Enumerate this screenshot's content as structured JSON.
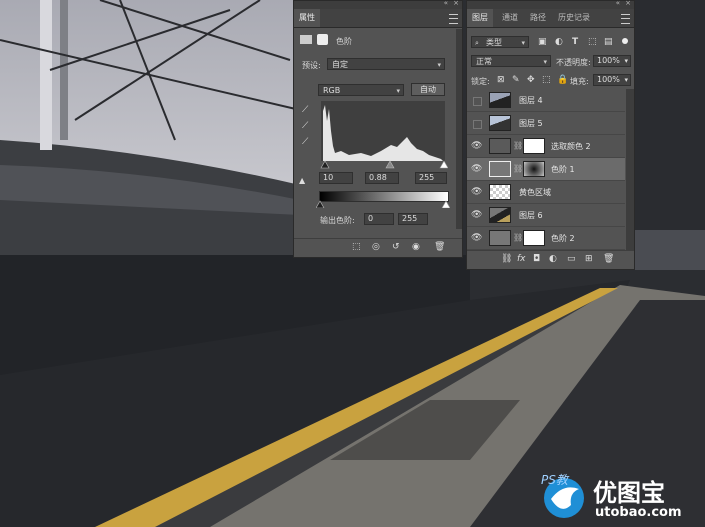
{
  "properties": {
    "tab_title": "属性",
    "adjustment_name": "色阶",
    "preset_label": "预设:",
    "preset_value": "自定",
    "channel_value": "RGB",
    "auto_label": "自动",
    "input_black": "10",
    "input_gamma": "0.88",
    "input_white": "255",
    "output_label": "输出色阶:",
    "output_black": "0",
    "output_white": "255"
  },
  "layers": {
    "tabs": [
      "图层",
      "通道",
      "路径",
      "历史记录"
    ],
    "filter_value": "类型",
    "blend_mode": "正常",
    "opacity_label": "不透明度:",
    "opacity_value": "100%",
    "lock_label": "锁定:",
    "fill_label": "填充:",
    "fill_value": "100%",
    "items": [
      {
        "name": "图层 4",
        "visible": false,
        "kind": "photo"
      },
      {
        "name": "图层 5",
        "visible": false,
        "kind": "photo"
      },
      {
        "name": "选取颜色 2",
        "visible": true,
        "kind": "adjust-mask"
      },
      {
        "name": "色阶 1",
        "visible": true,
        "kind": "levels-mask",
        "selected": true
      },
      {
        "name": "黄色区域",
        "visible": true,
        "kind": "transparent"
      },
      {
        "name": "图层 6",
        "visible": true,
        "kind": "photo"
      },
      {
        "name": "色阶 2",
        "visible": true,
        "kind": "levels-mask"
      }
    ]
  },
  "watermark": {
    "brand": "优图宝",
    "url": "utobao.com",
    "ps_text": "PS教"
  },
  "icons": {
    "visibility": "eye-icon",
    "link": "chain-link-icon",
    "histogram": "levels-histogram-icon",
    "eyedropper": "eyedropper-icon",
    "warning": "clipping-warning-icon"
  }
}
